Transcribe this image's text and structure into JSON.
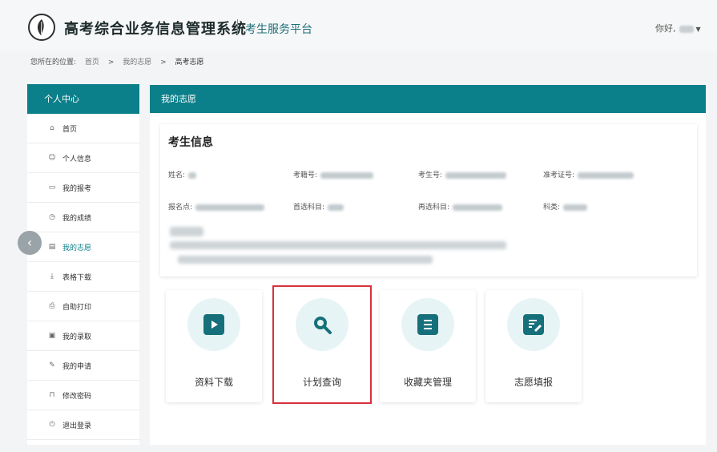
{
  "header": {
    "title": "高考综合业务信息管理系统",
    "subtitle": "考生服务平台",
    "greeting": "你好,",
    "logo_icon": "leaf-emblem-icon",
    "user_menu_icon": "caret-down-icon"
  },
  "breadcrumb": {
    "prefix": "您所在的位置:",
    "items": [
      "首页",
      "我的志愿",
      "高考志愿"
    ],
    "separator": ">"
  },
  "sidebar": {
    "header": "个人中心",
    "items": [
      {
        "label": "首页",
        "icon": "home-icon"
      },
      {
        "label": "个人信息",
        "icon": "user-icon"
      },
      {
        "label": "我的报考",
        "icon": "card-icon"
      },
      {
        "label": "我的成绩",
        "icon": "clock-icon"
      },
      {
        "label": "我的志愿",
        "icon": "document-icon"
      },
      {
        "label": "表格下载",
        "icon": "download-icon"
      },
      {
        "label": "自助打印",
        "icon": "printer-icon"
      },
      {
        "label": "我的录取",
        "icon": "calendar-icon"
      },
      {
        "label": "我的申请",
        "icon": "edit-icon"
      },
      {
        "label": "修改密码",
        "icon": "lock-icon"
      },
      {
        "label": "退出登录",
        "icon": "logout-icon"
      }
    ]
  },
  "main": {
    "panel_title": "我的志愿",
    "info": {
      "title": "考生信息",
      "row1": [
        {
          "label": "姓名:"
        },
        {
          "label": "考籍号:"
        },
        {
          "label": "考生号:"
        },
        {
          "label": "准考证号:"
        }
      ],
      "row2": [
        {
          "label": "报名点:"
        },
        {
          "label": "首选科目:"
        },
        {
          "label": "再选科目:"
        },
        {
          "label": "科类:"
        }
      ]
    },
    "tiles": [
      {
        "label": "资料下载",
        "icon": "play-icon"
      },
      {
        "label": "计划查询",
        "icon": "search-icon"
      },
      {
        "label": "收藏夹管理",
        "icon": "list-icon"
      },
      {
        "label": "志愿填报",
        "icon": "edit-doc-icon"
      }
    ]
  },
  "colors": {
    "brand": "#0b7f8a",
    "icon": "#16707b",
    "icon_bg": "#e7f4f5",
    "highlight": "#d8323c"
  }
}
